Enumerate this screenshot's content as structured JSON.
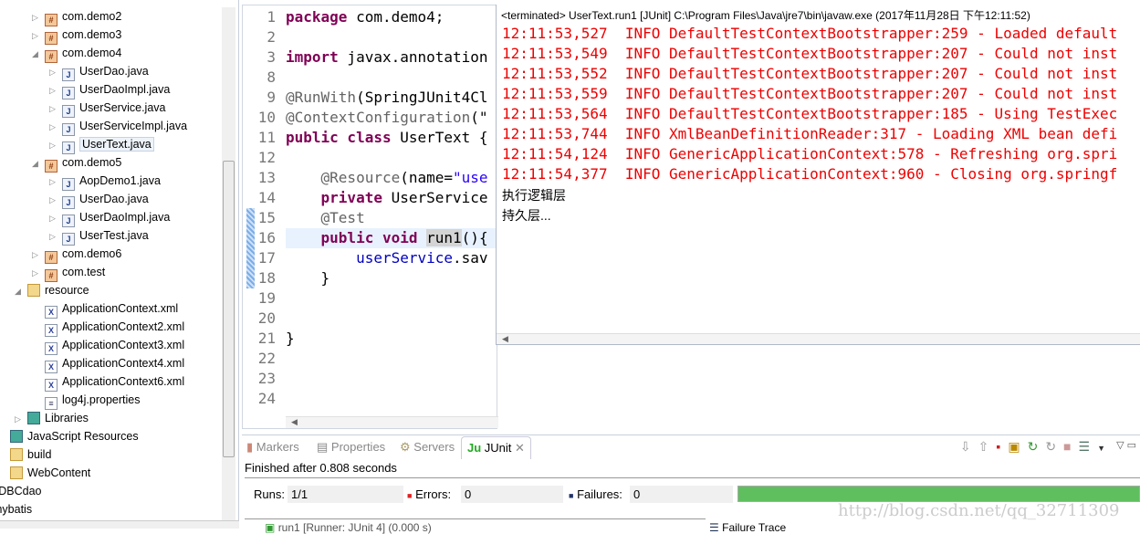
{
  "tree": {
    "items": [
      {
        "label": "com.demo2",
        "depth": 1,
        "icon": "package-icon",
        "tw": "closed"
      },
      {
        "label": "com.demo3",
        "depth": 1,
        "icon": "package-warning-icon",
        "tw": "closed"
      },
      {
        "label": "com.demo4",
        "depth": 1,
        "icon": "package-icon",
        "tw": "open"
      },
      {
        "label": "UserDao.java",
        "depth": 2,
        "icon": "java-file-icon",
        "tw": "closed"
      },
      {
        "label": "UserDaoImpl.java",
        "depth": 2,
        "icon": "java-file-icon",
        "tw": "closed"
      },
      {
        "label": "UserService.java",
        "depth": 2,
        "icon": "java-file-icon",
        "tw": "closed"
      },
      {
        "label": "UserServiceImpl.java",
        "depth": 2,
        "icon": "java-file-icon",
        "tw": "closed"
      },
      {
        "label": "UserText.java",
        "depth": 2,
        "icon": "java-file-icon",
        "tw": "closed",
        "selected": true
      },
      {
        "label": "com.demo5",
        "depth": 1,
        "icon": "package-icon",
        "tw": "open"
      },
      {
        "label": "AopDemo1.java",
        "depth": 2,
        "icon": "java-file-icon",
        "tw": "closed"
      },
      {
        "label": "UserDao.java",
        "depth": 2,
        "icon": "java-file-icon",
        "tw": "closed"
      },
      {
        "label": "UserDaoImpl.java",
        "depth": 2,
        "icon": "java-file-icon",
        "tw": "closed"
      },
      {
        "label": "UserTest.java",
        "depth": 2,
        "icon": "java-file-icon",
        "tw": "closed"
      },
      {
        "label": "com.demo6",
        "depth": 1,
        "icon": "package-warning-icon",
        "tw": "closed"
      },
      {
        "label": "com.test",
        "depth": 1,
        "icon": "package-warning-icon",
        "tw": "closed"
      },
      {
        "label": "resource",
        "depth": 0,
        "icon": "source-folder-icon",
        "tw": "open"
      },
      {
        "label": "ApplicationContext.xml",
        "depth": 1,
        "icon": "xml-file-icon",
        "tw": "none"
      },
      {
        "label": "ApplicationContext2.xml",
        "depth": 1,
        "icon": "xml-file-icon",
        "tw": "none"
      },
      {
        "label": "ApplicationContext3.xml",
        "depth": 1,
        "icon": "xml-file-icon",
        "tw": "none"
      },
      {
        "label": "ApplicationContext4.xml",
        "depth": 1,
        "icon": "xml-file-icon",
        "tw": "none"
      },
      {
        "label": "ApplicationContext6.xml",
        "depth": 1,
        "icon": "xml-file-icon",
        "tw": "none"
      },
      {
        "label": "log4j.properties",
        "depth": 1,
        "icon": "properties-file-icon",
        "tw": "none"
      },
      {
        "label": "Libraries",
        "depth": 0,
        "icon": "library-icon",
        "tw": "closed"
      },
      {
        "label": "JavaScript Resources",
        "depth": -1,
        "icon": "library-icon",
        "tw": "none"
      },
      {
        "label": "build",
        "depth": -1,
        "icon": "folder-icon",
        "tw": "none"
      },
      {
        "label": "WebContent",
        "depth": -1,
        "icon": "folder-icon",
        "tw": "none"
      },
      {
        "label": "JDBCdao",
        "depth": -2,
        "icon": "",
        "tw": "none"
      },
      {
        "label": "mybatis",
        "depth": -2,
        "icon": "",
        "tw": "none"
      }
    ]
  },
  "editor": {
    "lines": [
      {
        "n": "1",
        "html": "<span class='kw'>package</span> com.demo4;"
      },
      {
        "n": "2",
        "html": ""
      },
      {
        "n": "3",
        "html": "<span class='kw'>import</span> javax.annotation"
      },
      {
        "n": "8",
        "html": ""
      },
      {
        "n": "9",
        "html": "<span class='an'>@RunWith</span>(SpringJUnit4Cl"
      },
      {
        "n": "10",
        "html": "<span class='an'>@ContextConfiguration</span>(\""
      },
      {
        "n": "11",
        "html": "<span class='kw'>public class</span> UserText {"
      },
      {
        "n": "12",
        "html": ""
      },
      {
        "n": "13",
        "html": "    <span class='an'>@Resource</span>(name=<span class='str'>\"use</span>"
      },
      {
        "n": "14",
        "html": "    <span class='kw'>private</span> UserService"
      },
      {
        "n": "15",
        "html": "    <span class='an'>@Test</span>"
      },
      {
        "n": "16",
        "html": "    <span class='kw'>public void</span> <span style='background:#d4d4d4'>run1</span>(){"
      },
      {
        "n": "17",
        "html": "        <span class='fd'>userService</span>.sav"
      },
      {
        "n": "18",
        "html": "    }"
      },
      {
        "n": "19",
        "html": ""
      },
      {
        "n": "20",
        "html": ""
      },
      {
        "n": "21",
        "html": "}"
      },
      {
        "n": "22",
        "html": ""
      },
      {
        "n": "23",
        "html": ""
      },
      {
        "n": "24",
        "html": ""
      }
    ]
  },
  "console": {
    "header": "<terminated> UserText.run1 [JUnit] C:\\Program Files\\Java\\jre7\\bin\\javaw.exe (2017年11月28日 下午12:11:52)",
    "logs": [
      "12:11:53,527  INFO DefaultTestContextBootstrapper:259 - Loaded default",
      "12:11:53,549  INFO DefaultTestContextBootstrapper:207 - Could not inst",
      "12:11:53,552  INFO DefaultTestContextBootstrapper:207 - Could not inst",
      "12:11:53,559  INFO DefaultTestContextBootstrapper:207 - Could not inst",
      "12:11:53,564  INFO DefaultTestContextBootstrapper:185 - Using TestExec",
      "12:11:53,744  INFO XmlBeanDefinitionReader:317 - Loading XML bean defi",
      "12:11:54,124  INFO GenericApplicationContext:578 - Refreshing org.spri",
      "12:11:54,377  INFO GenericApplicationContext:960 - Closing org.springf"
    ],
    "output": [
      "执行逻辑层",
      "持久层..."
    ]
  },
  "junit": {
    "tabs": [
      "Markers",
      "Properties",
      "Servers",
      "JUnit"
    ],
    "finished": "Finished after 0.808 seconds",
    "runs_label": "Runs:",
    "runs": "1/1",
    "errors_label": "Errors:",
    "errors": "0",
    "failures_label": "Failures:",
    "failures": "0",
    "progress": 1.0,
    "progress_color": "#5fbf5f",
    "test_item": "run1 [Runner: JUnit 4] (0.000 s)",
    "failure_trace": "Failure Trace",
    "watermark": "http://blog.csdn.net/qq_32711309"
  }
}
